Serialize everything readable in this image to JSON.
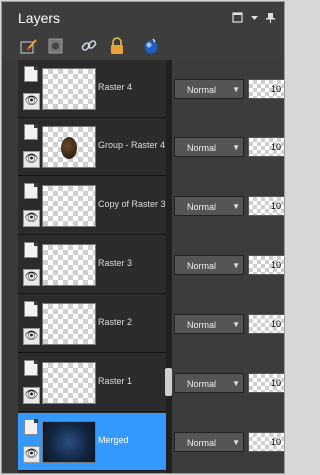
{
  "panel": {
    "title": "Layers"
  },
  "title_bar_icons": [
    "maximize-icon",
    "menu-arrow-icon",
    "pin-icon"
  ],
  "toolbar": [
    "layer-brush-icon",
    "mask-icon",
    "link-icon",
    "lock-icon",
    "blend-ball-icon"
  ],
  "layers": [
    {
      "name": "Raster 4",
      "thumb": "transparent",
      "blend": "Normal",
      "opacity": "10",
      "selected": false
    },
    {
      "name": "Group - Raster 4",
      "thumb": "object",
      "blend": "Normal",
      "opacity": "10",
      "selected": false
    },
    {
      "name": "Copy of Raster 3",
      "thumb": "transparent",
      "blend": "Normal",
      "opacity": "10",
      "selected": false
    },
    {
      "name": "Raster 3",
      "thumb": "transparent",
      "blend": "Normal",
      "opacity": "10",
      "selected": false
    },
    {
      "name": "Raster 2",
      "thumb": "transparent",
      "blend": "Normal",
      "opacity": "10",
      "selected": false
    },
    {
      "name": "Raster 1",
      "thumb": "transparent",
      "blend": "Normal",
      "opacity": "10",
      "selected": false
    },
    {
      "name": "Merged",
      "thumb": "dark",
      "blend": "Normal",
      "opacity": "10",
      "selected": true
    }
  ],
  "colors": {
    "selected": "#3399ff",
    "panel": "#3c3c3c",
    "list": "#2b2b2b"
  }
}
